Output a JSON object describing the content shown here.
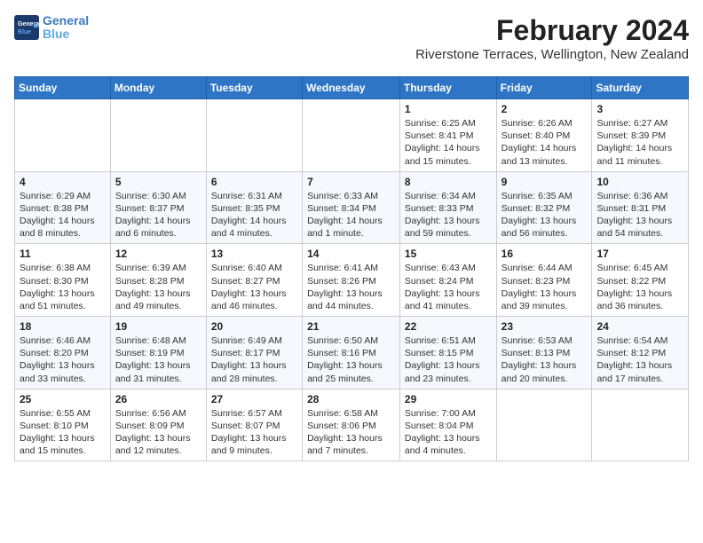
{
  "logo": {
    "line1": "General",
    "line2": "Blue"
  },
  "title": "February 2024",
  "subtitle": "Riverstone Terraces, Wellington, New Zealand",
  "calendar": {
    "headers": [
      "Sunday",
      "Monday",
      "Tuesday",
      "Wednesday",
      "Thursday",
      "Friday",
      "Saturday"
    ],
    "weeks": [
      [
        {
          "day": "",
          "info": ""
        },
        {
          "day": "",
          "info": ""
        },
        {
          "day": "",
          "info": ""
        },
        {
          "day": "",
          "info": ""
        },
        {
          "day": "1",
          "info": "Sunrise: 6:25 AM\nSunset: 8:41 PM\nDaylight: 14 hours\nand 15 minutes."
        },
        {
          "day": "2",
          "info": "Sunrise: 6:26 AM\nSunset: 8:40 PM\nDaylight: 14 hours\nand 13 minutes."
        },
        {
          "day": "3",
          "info": "Sunrise: 6:27 AM\nSunset: 8:39 PM\nDaylight: 14 hours\nand 11 minutes."
        }
      ],
      [
        {
          "day": "4",
          "info": "Sunrise: 6:29 AM\nSunset: 8:38 PM\nDaylight: 14 hours\nand 8 minutes."
        },
        {
          "day": "5",
          "info": "Sunrise: 6:30 AM\nSunset: 8:37 PM\nDaylight: 14 hours\nand 6 minutes."
        },
        {
          "day": "6",
          "info": "Sunrise: 6:31 AM\nSunset: 8:35 PM\nDaylight: 14 hours\nand 4 minutes."
        },
        {
          "day": "7",
          "info": "Sunrise: 6:33 AM\nSunset: 8:34 PM\nDaylight: 14 hours\nand 1 minute."
        },
        {
          "day": "8",
          "info": "Sunrise: 6:34 AM\nSunset: 8:33 PM\nDaylight: 13 hours\nand 59 minutes."
        },
        {
          "day": "9",
          "info": "Sunrise: 6:35 AM\nSunset: 8:32 PM\nDaylight: 13 hours\nand 56 minutes."
        },
        {
          "day": "10",
          "info": "Sunrise: 6:36 AM\nSunset: 8:31 PM\nDaylight: 13 hours\nand 54 minutes."
        }
      ],
      [
        {
          "day": "11",
          "info": "Sunrise: 6:38 AM\nSunset: 8:30 PM\nDaylight: 13 hours\nand 51 minutes."
        },
        {
          "day": "12",
          "info": "Sunrise: 6:39 AM\nSunset: 8:28 PM\nDaylight: 13 hours\nand 49 minutes."
        },
        {
          "day": "13",
          "info": "Sunrise: 6:40 AM\nSunset: 8:27 PM\nDaylight: 13 hours\nand 46 minutes."
        },
        {
          "day": "14",
          "info": "Sunrise: 6:41 AM\nSunset: 8:26 PM\nDaylight: 13 hours\nand 44 minutes."
        },
        {
          "day": "15",
          "info": "Sunrise: 6:43 AM\nSunset: 8:24 PM\nDaylight: 13 hours\nand 41 minutes."
        },
        {
          "day": "16",
          "info": "Sunrise: 6:44 AM\nSunset: 8:23 PM\nDaylight: 13 hours\nand 39 minutes."
        },
        {
          "day": "17",
          "info": "Sunrise: 6:45 AM\nSunset: 8:22 PM\nDaylight: 13 hours\nand 36 minutes."
        }
      ],
      [
        {
          "day": "18",
          "info": "Sunrise: 6:46 AM\nSunset: 8:20 PM\nDaylight: 13 hours\nand 33 minutes."
        },
        {
          "day": "19",
          "info": "Sunrise: 6:48 AM\nSunset: 8:19 PM\nDaylight: 13 hours\nand 31 minutes."
        },
        {
          "day": "20",
          "info": "Sunrise: 6:49 AM\nSunset: 8:17 PM\nDaylight: 13 hours\nand 28 minutes."
        },
        {
          "day": "21",
          "info": "Sunrise: 6:50 AM\nSunset: 8:16 PM\nDaylight: 13 hours\nand 25 minutes."
        },
        {
          "day": "22",
          "info": "Sunrise: 6:51 AM\nSunset: 8:15 PM\nDaylight: 13 hours\nand 23 minutes."
        },
        {
          "day": "23",
          "info": "Sunrise: 6:53 AM\nSunset: 8:13 PM\nDaylight: 13 hours\nand 20 minutes."
        },
        {
          "day": "24",
          "info": "Sunrise: 6:54 AM\nSunset: 8:12 PM\nDaylight: 13 hours\nand 17 minutes."
        }
      ],
      [
        {
          "day": "25",
          "info": "Sunrise: 6:55 AM\nSunset: 8:10 PM\nDaylight: 13 hours\nand 15 minutes."
        },
        {
          "day": "26",
          "info": "Sunrise: 6:56 AM\nSunset: 8:09 PM\nDaylight: 13 hours\nand 12 minutes."
        },
        {
          "day": "27",
          "info": "Sunrise: 6:57 AM\nSunset: 8:07 PM\nDaylight: 13 hours\nand 9 minutes."
        },
        {
          "day": "28",
          "info": "Sunrise: 6:58 AM\nSunset: 8:06 PM\nDaylight: 13 hours\nand 7 minutes."
        },
        {
          "day": "29",
          "info": "Sunrise: 7:00 AM\nSunset: 8:04 PM\nDaylight: 13 hours\nand 4 minutes."
        },
        {
          "day": "",
          "info": ""
        },
        {
          "day": "",
          "info": ""
        }
      ]
    ]
  }
}
